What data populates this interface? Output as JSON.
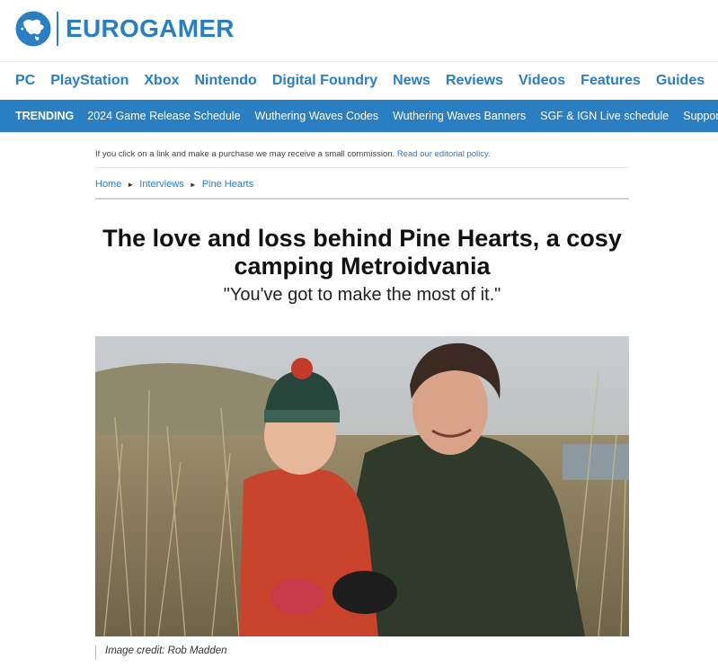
{
  "site": {
    "logo_text": "EUROGAMER",
    "logo_icon": "europe-globe-icon",
    "brand_color": "#2a7ec2"
  },
  "nav": {
    "items": [
      "PC",
      "PlayStation",
      "Xbox",
      "Nintendo",
      "Digital Foundry",
      "News",
      "Reviews",
      "Videos",
      "Features",
      "Guides"
    ]
  },
  "trending": {
    "label": "TRENDING",
    "links": [
      "2024 Game Release Schedule",
      "Wuthering Waves Codes",
      "Wuthering Waves Banners",
      "SGF & IGN Live schedule",
      "Supporter"
    ]
  },
  "article": {
    "disclosure_text": "If you click on a link and make a purchase we may receive a small commission.",
    "disclosure_link": "Read our editorial policy.",
    "breadcrumb": [
      "Home",
      "Interviews",
      "Pine Hearts"
    ],
    "breadcrumb_separator": "►",
    "headline": "The love and loss behind Pine Hearts, a cosy camping Metroidvania",
    "strapline": "\"You've got to make the most of it.\"",
    "image_credit": "Image credit: Rob Madden"
  }
}
